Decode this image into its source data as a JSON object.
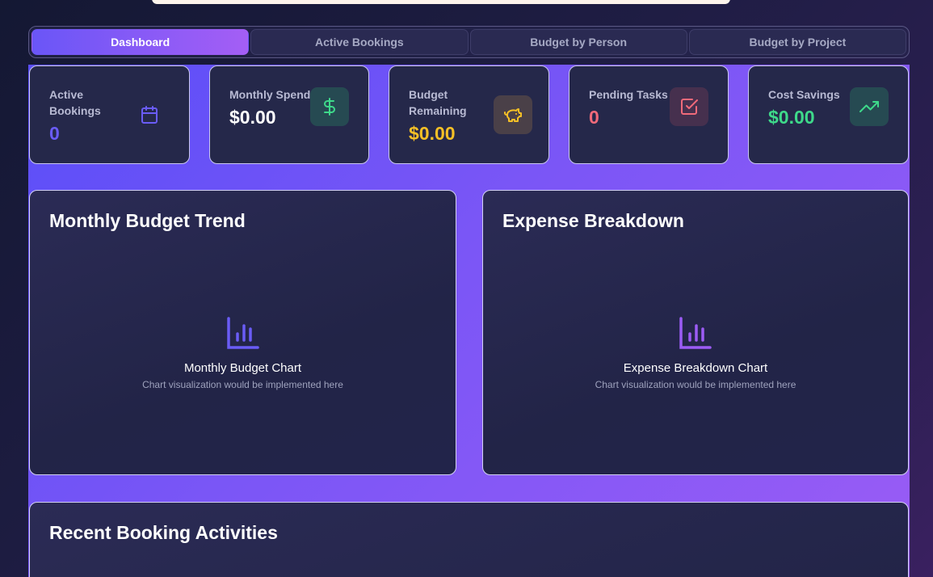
{
  "tabs": [
    {
      "label": "Dashboard",
      "active": true
    },
    {
      "label": "Active Bookings",
      "active": false
    },
    {
      "label": "Budget by Person",
      "active": false
    },
    {
      "label": "Budget by Project",
      "active": false
    }
  ],
  "stats": {
    "active_bookings": {
      "label_line1": "Active",
      "label_line2": "Bookings",
      "value": "0",
      "color": "#6a5cf6",
      "icon": "calendar-icon"
    },
    "monthly_spend": {
      "label": "Monthly Spend",
      "value": "$0.00",
      "color": "#ffffff",
      "icon": "dollar-icon"
    },
    "budget_remaining": {
      "label_line1": "Budget",
      "label_line2": "Remaining",
      "value": "$0.00",
      "color": "#f6c026",
      "icon": "piggy-bank-icon"
    },
    "pending_tasks": {
      "label": "Pending Tasks",
      "value": "0",
      "color": "#f06a7a",
      "icon": "check-square-icon"
    },
    "cost_savings": {
      "label": "Cost Savings",
      "value": "$0.00",
      "color": "#3ed98a",
      "icon": "trending-up-icon"
    }
  },
  "charts": {
    "monthly": {
      "title": "Monthly Budget Trend",
      "placeholder_title": "Monthly Budget Chart",
      "placeholder_sub": "Chart visualization would be implemented here",
      "icon": "bar-chart-icon"
    },
    "expense": {
      "title": "Expense Breakdown",
      "placeholder_title": "Expense Breakdown Chart",
      "placeholder_sub": "Chart visualization would be implemented here",
      "icon": "bar-chart-icon"
    }
  },
  "recent": {
    "title": "Recent Booking Activities"
  }
}
